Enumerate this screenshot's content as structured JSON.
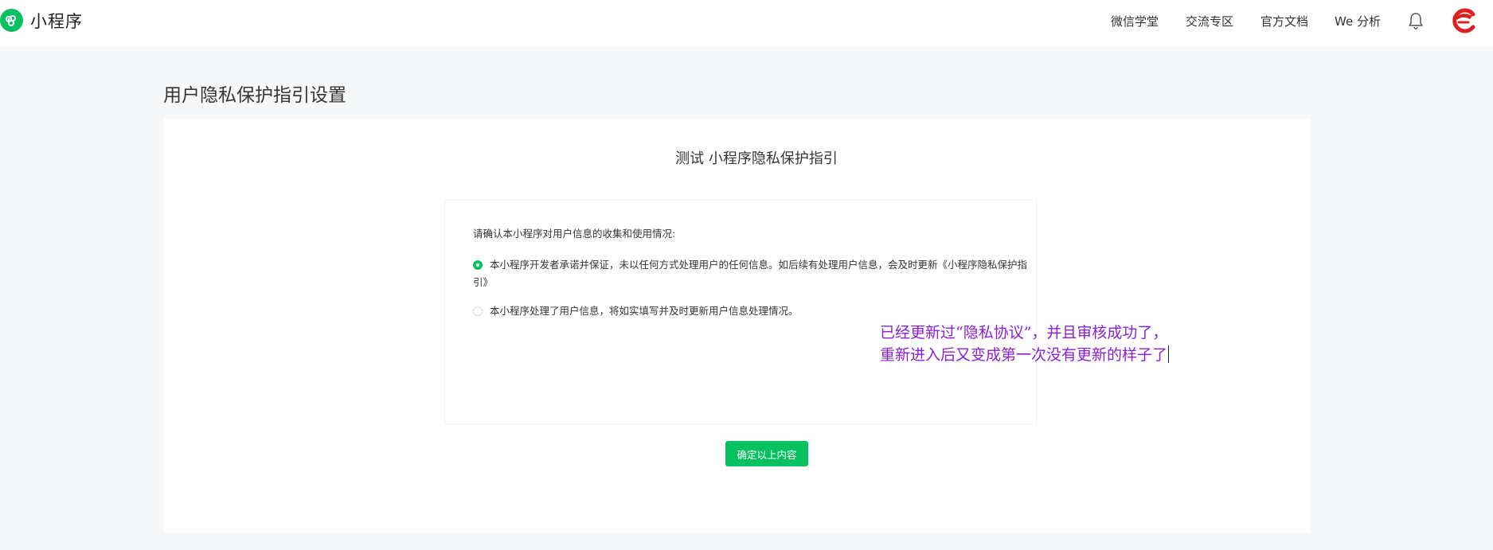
{
  "header": {
    "brand": "小程序",
    "nav": [
      "微信学堂",
      "交流专区",
      "官方文档",
      "We 分析"
    ]
  },
  "page": {
    "title": "用户隐私保护指引设置"
  },
  "guide": {
    "title_partial": "测试 小程序隐私保护指引",
    "prompt": "请确认本小程序对用户信息的收集和使用情况:",
    "options": [
      {
        "label": "本小程序开发者承诺并保证，未以任何方式处理用户的任何信息。如后续有处理用户信息，会及时更新《小程序隐私保护指引》",
        "selected": true
      },
      {
        "label": "本小程序处理了用户信息，将如实填写并及时更新用户信息处理情况。",
        "selected": false
      }
    ],
    "confirm_label": "确定以上内容"
  },
  "annotation": {
    "line1": "已经更新过“隐私协议”，并且审核成功了，",
    "line2": "重新进入后又变成第一次没有更新的样子了"
  },
  "colors": {
    "accent": "#07c160",
    "annotation": "#8b1fd6"
  },
  "icons": [
    "miniprogram-logo-icon",
    "bell-icon",
    "avatar-logo-icon"
  ]
}
